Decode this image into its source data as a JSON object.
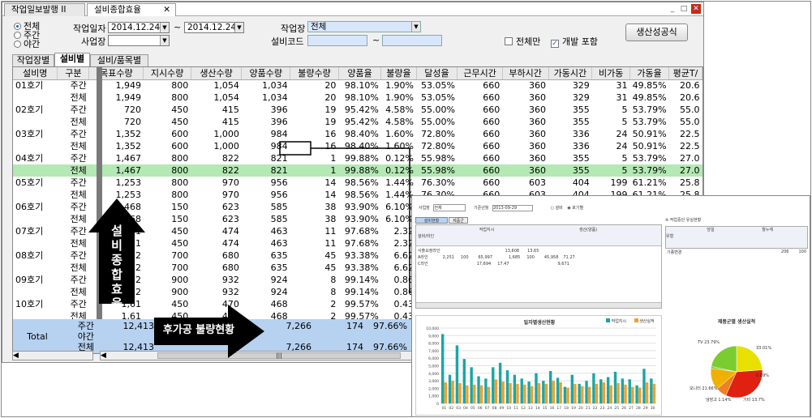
{
  "tabs": [
    {
      "label": "작업일보발행 II"
    },
    {
      "label": "설비종합효율"
    }
  ],
  "window": {
    "min": "_",
    "restore": "□",
    "close": "✕"
  },
  "period": {
    "options": [
      "전체",
      "주간",
      "야간"
    ],
    "selected": "전체"
  },
  "filters": {
    "work_date_label": "작업일자",
    "date_from": "2014.12.24",
    "tilde": "~",
    "date_to": "2014.12.24",
    "business_label": "사업장",
    "business_value": "",
    "workplace_label": "작업장",
    "workplace_value": "전체",
    "equip_code_label": "설비코드",
    "equip_from": "",
    "equip_to": "",
    "all_only_label": "전체만",
    "all_only_checked": false,
    "dev_include_label": "개발 포함",
    "dev_include_checked": true,
    "generate_button": "생산성공식"
  },
  "subtabs": [
    "작업장별",
    "설비별",
    "설비/품목별"
  ],
  "subtab_active": "설비별",
  "table": {
    "columns": [
      "설비명",
      "구분",
      "목표수량",
      "지시수량",
      "생산수량",
      "양품수량",
      "불량수량",
      "양품율",
      "불량율",
      "달성율",
      "근무시간",
      "부하시간",
      "가동시간",
      "비가동",
      "가동율",
      "평균T/"
    ],
    "rows": [
      [
        "01호기",
        "주간",
        "1,949",
        "800",
        "1,054",
        "1,034",
        "20",
        "98.10%",
        "1.90%",
        "53.05%",
        "660",
        "360",
        "329",
        "31",
        "49.85%",
        "20.6"
      ],
      [
        "",
        "전체",
        "1,949",
        "800",
        "1,054",
        "1,034",
        "20",
        "98.10%",
        "1.90%",
        "53.05%",
        "660",
        "360",
        "329",
        "31",
        "49.85%",
        "20.6"
      ],
      [
        "02호기",
        "주간",
        "720",
        "450",
        "415",
        "396",
        "19",
        "95.42%",
        "4.58%",
        "55.00%",
        "660",
        "360",
        "355",
        "5",
        "53.79%",
        "55.0"
      ],
      [
        "",
        "전체",
        "720",
        "450",
        "415",
        "396",
        "19",
        "95.42%",
        "4.58%",
        "55.00%",
        "660",
        "360",
        "355",
        "5",
        "53.79%",
        "55.0"
      ],
      [
        "03호기",
        "주간",
        "1,352",
        "600",
        "1,000",
        "984",
        "16",
        "98.40%",
        "1.60%",
        "72.80%",
        "660",
        "360",
        "336",
        "24",
        "50.91%",
        "22.5"
      ],
      [
        "",
        "전체",
        "1,352",
        "600",
        "1,000",
        "984",
        "16",
        "98.40%",
        "1.60%",
        "72.80%",
        "660",
        "360",
        "336",
        "24",
        "50.91%",
        "22.5"
      ],
      [
        "04호기",
        "주간",
        "1,467",
        "800",
        "822",
        "821",
        "1",
        "99.88%",
        "0.12%",
        "55.98%",
        "660",
        "360",
        "355",
        "5",
        "53.79%",
        "27.0"
      ],
      [
        "",
        "전체",
        "1,467",
        "800",
        "822",
        "821",
        "1",
        "99.88%",
        "0.12%",
        "55.98%",
        "660",
        "360",
        "355",
        "5",
        "53.79%",
        "27.0"
      ],
      [
        "05호기",
        "주간",
        "1,253",
        "800",
        "970",
        "956",
        "14",
        "98.56%",
        "1.44%",
        "76.30%",
        "660",
        "603",
        "404",
        "199",
        "61.21%",
        "25.8"
      ],
      [
        "",
        "전체",
        "1,253",
        "800",
        "970",
        "956",
        "14",
        "98.56%",
        "1.44%",
        "76.30%",
        "660",
        "603",
        "404",
        "199",
        "61.21%",
        "25.8"
      ],
      [
        "06호기",
        "주간",
        "1,468",
        "150",
        "623",
        "585",
        "38",
        "93.90%",
        "6.10%",
        "39.85%",
        "660",
        "360",
        "315",
        "45",
        "47.73%",
        "32.6"
      ],
      [
        "",
        "전체",
        "1,468",
        "150",
        "623",
        "585",
        "38",
        "93.90%",
        "6.10%",
        "",
        "",
        "",
        "",
        "",
        "",
        ""
      ],
      [
        "07호기",
        "주간",
        "1,51",
        "450",
        "474",
        "463",
        "11",
        "97.68%",
        "2.32",
        "",
        "",
        "",
        "",
        "",
        "",
        ""
      ],
      [
        "",
        "전체",
        "1,51",
        "450",
        "474",
        "463",
        "11",
        "97.68%",
        "2.32",
        "",
        "",
        "",
        "",
        "",
        "",
        ""
      ],
      [
        "08호기",
        "주간",
        "1,52",
        "700",
        "680",
        "635",
        "45",
        "93.38%",
        "6.62",
        "",
        "",
        "",
        "",
        "",
        "",
        ""
      ],
      [
        "",
        "전체",
        "1,52",
        "700",
        "680",
        "635",
        "45",
        "93.38%",
        "6.62",
        "",
        "",
        "",
        "",
        "",
        "",
        ""
      ],
      [
        "09호기",
        "주간",
        "1,22",
        "900",
        "932",
        "924",
        "8",
        "99.14%",
        "0.86",
        "",
        "",
        "",
        "",
        "",
        "",
        ""
      ],
      [
        "",
        "전체",
        "1,22",
        "900",
        "932",
        "924",
        "8",
        "99.14%",
        "0.86",
        "",
        "",
        "",
        "",
        "",
        "",
        ""
      ],
      [
        "10호기",
        "주간",
        "1,61",
        "450",
        "470",
        "468",
        "2",
        "99.57%",
        "0.43",
        "",
        "",
        "",
        "",
        "",
        "",
        ""
      ],
      [
        "",
        "전체",
        "1,61",
        "450",
        "470",
        "468",
        "2",
        "99.57%",
        "0.43",
        "",
        "",
        "",
        "",
        "",
        "",
        ""
      ]
    ],
    "highlight_row": 7,
    "totals": {
      "label": "Total",
      "rows": [
        [
          "주간",
          "12,413",
          "",
          "",
          "7,266",
          "174",
          "97.66%",
          "2.34"
        ],
        [
          "야간",
          "",
          "",
          "",
          "",
          "",
          "",
          ""
        ],
        [
          "전체",
          "12,413",
          "",
          "",
          "7,266",
          "174",
          "97.66%",
          "2.34"
        ]
      ]
    }
  },
  "annotations": {
    "vertical": "설비종합효율",
    "horizontal": "후가공 불량현황"
  },
  "overlay": {
    "filter_labels": [
      "사업장",
      "전체",
      "기준년월",
      "2013-09-29",
      "설비",
      "호기별"
    ],
    "tabs": [
      "설비현황",
      "제품군"
    ],
    "left_table_headers": [
      "설비/라인",
      "작업지시",
      "생산(양품)",
      "당일",
      "월누계",
      "수량",
      "점유율"
    ],
    "left_table_rows": [
      [
        "사출요정라인",
        "",
        "",
        "13,608",
        "13.65"
      ],
      [
        "A라인",
        "2,251",
        "100",
        "65,997",
        "",
        "1,685",
        "100",
        "45,958",
        "71.27"
      ],
      [
        "C라인",
        "",
        "",
        "17,694",
        "17.47",
        "",
        "",
        "9,671",
        "15"
      ]
    ],
    "right_panel_title": "※ 작업중단 유실현황",
    "right_table_headers": [
      "유형",
      "당일",
      "월누계",
      "시간(분)",
      "점유율"
    ],
    "right_table_rows": [
      [
        "기종변경",
        "",
        "",
        "206",
        "100"
      ]
    ],
    "bar_chart_title": "일자별생산현황",
    "bar_legend": [
      "작업지시",
      "생산실적"
    ],
    "pie_chart_title": "제품군별 생산실적",
    "pie_labels": [
      {
        "text": "TV 23.79%"
      },
      {
        "text": "33.01%"
      },
      {
        "text": "모니터 21.66%"
      },
      {
        "text": "6.69%"
      },
      {
        "text": "냉장고 1.14%"
      },
      {
        "text": "기타 13.7%"
      }
    ]
  },
  "chart_data": [
    {
      "type": "bar",
      "title": "일자별생산현황",
      "ylim": [
        0,
        10000
      ],
      "yticks": [
        "10,000",
        "9,000",
        "8,000",
        "7,000",
        "6,000",
        "5,000",
        "4,000",
        "3,000",
        "2,000",
        "1,000",
        "0"
      ],
      "categories": [
        "01",
        "02",
        "03",
        "04",
        "05",
        "06",
        "07",
        "08",
        "09",
        "10",
        "11",
        "12",
        "13",
        "14",
        "15",
        "16",
        "17",
        "18",
        "19",
        "20",
        "21",
        "22",
        "23",
        "24",
        "25",
        "26",
        "27",
        "28",
        "29",
        "30"
      ],
      "series": [
        {
          "name": "작업지시",
          "color": "#1aa6a6",
          "values": [
            9200,
            3800,
            7700,
            5900,
            4800,
            3600,
            3300,
            4800,
            5400,
            4400,
            3800,
            3300,
            2900,
            4000,
            3000,
            4300,
            3400,
            2200,
            3800,
            2600,
            3000,
            4000,
            3200,
            3500,
            4200,
            3300,
            3200,
            2400,
            4600,
            3300
          ]
        },
        {
          "name": "생산실적",
          "color": "#f0a030",
          "values": [
            2800,
            3000,
            2700,
            2400,
            2500,
            2400,
            2200,
            3200,
            2900,
            2700,
            2600,
            2500,
            2300,
            2700,
            2600,
            3000,
            2800,
            2100,
            2600,
            2300,
            2200,
            2600,
            2800,
            2400,
            2700,
            2500,
            2200,
            2100,
            2800,
            2600
          ]
        }
      ]
    },
    {
      "type": "pie",
      "title": "제품군별 생산실적",
      "slices": [
        {
          "label": "TV",
          "value": 23.79,
          "color": "#e8e000"
        },
        {
          "label": "",
          "value": 33.01,
          "color": "#e02010"
        },
        {
          "label": "",
          "value": 6.69,
          "color": "#f08020"
        },
        {
          "label": "기타",
          "value": 13.7,
          "color": "#f0b000"
        },
        {
          "label": "냉장고",
          "value": 1.14,
          "color": "#80c020"
        },
        {
          "label": "모니터",
          "value": 21.66,
          "color": "#7acc30"
        }
      ]
    }
  ]
}
